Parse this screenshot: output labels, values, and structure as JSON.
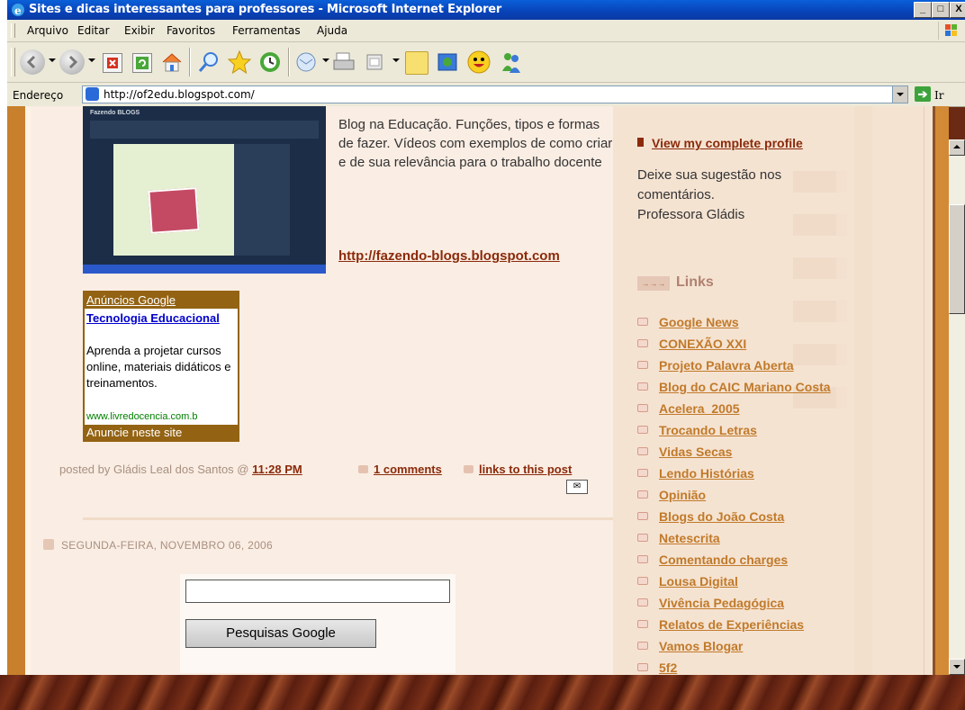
{
  "window": {
    "title": "Sites e dicas interessantes para professores - Microsoft Internet Explorer",
    "minimize": "_",
    "restore": "□",
    "close": "X"
  },
  "menu": [
    "Arquivo",
    "Editar",
    "Exibir",
    "Favoritos",
    "Ferramentas",
    "Ajuda"
  ],
  "address": {
    "label": "Endereço",
    "url": "http://of2edu.blogspot.com/",
    "go_label": "Ir"
  },
  "post": {
    "thumb_header": "Fazendo BLOGS",
    "description": "Blog na Educação. Funções, tipos e formas de fazer. Vídeos com exemplos de como criar e de sua relevância para o trabalho docente",
    "link": "http://fazendo-blogs.blogspot.com",
    "posted_by": "posted by Gládis Leal dos Santos @ ",
    "time": "11:28 PM",
    "comments": "1 comments",
    "links_to_post": "links to this post"
  },
  "ad": {
    "header": "Anúncios Google",
    "title": "Tecnologia Educacional",
    "description": "Aprenda a projetar cursos online, materiais didáticos e treinamentos.",
    "url": "www.livredocencia.com.b",
    "footer": "Anuncie neste site"
  },
  "date_header": "SEGUNDA-FEIRA, NOVEMBRO 06, 2006",
  "search": {
    "button": "Pesquisas Google",
    "value": ""
  },
  "sidebar": {
    "profile_link": "View my complete profile",
    "text_lines": [
      "Deixe sua sugestão nos",
      "comentários.",
      "Professora Gládis"
    ],
    "links_title": "Links",
    "links_arrow": "→→→",
    "links": [
      "Google News",
      "CONEXÃO XXI",
      "Projeto Palavra Aberta",
      "Blog do CAIC Mariano Costa",
      "Acelera_2005",
      "Trocando Letras",
      "Vidas Secas",
      "Lendo Histórias",
      "Opinião",
      "Blogs do João Costa",
      "Netescrita",
      "Comentando charges",
      "Lousa Digital",
      "Vivência Pedagógica",
      "Relatos de Experiências",
      "Vamos Blogar",
      "5f2"
    ]
  }
}
